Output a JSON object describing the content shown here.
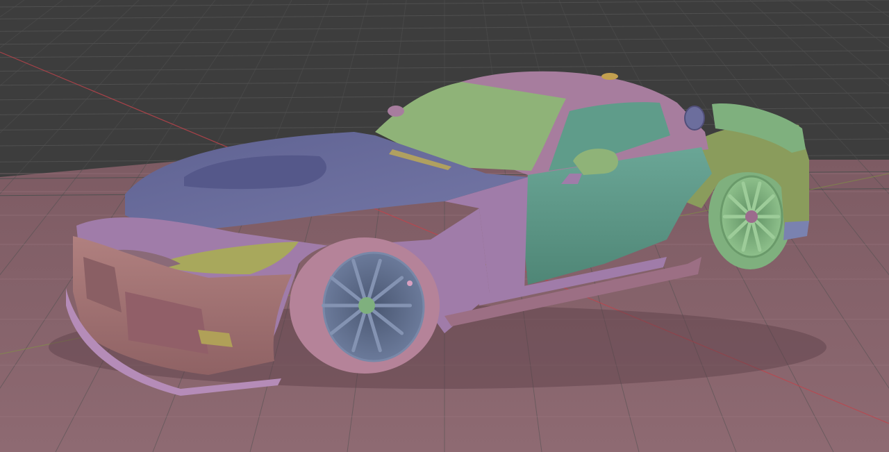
{
  "app": {
    "name": "",
    "window_title": ""
  },
  "viewport": {
    "view_label": "",
    "shading_label": "",
    "shading_mode": "random-color-solid",
    "background_color": "#3d3d3d",
    "grid_color": "#505050",
    "floor_color": "#8a636b",
    "axis_x_color": "#c0434b",
    "axis_y_color": "#7f9b3c"
  },
  "model": {
    "object_name": "",
    "part_colors": {
      "hood": "#6c6e9d",
      "roof": "#a77d9e",
      "windshield": "#8fb378",
      "side_panel": "#5f9c8a",
      "front_bumper": "#a9787d",
      "fender": "#a07ca9",
      "headlight": "#a8a85c",
      "rear_fender": "#8a9c5c",
      "wheel_front": "#5d6f8c",
      "tire_front": "#b58399",
      "wheel_rear": "#7fb07e",
      "splitter": "#b58cb8",
      "sideskirt": "#9c6f84"
    }
  }
}
